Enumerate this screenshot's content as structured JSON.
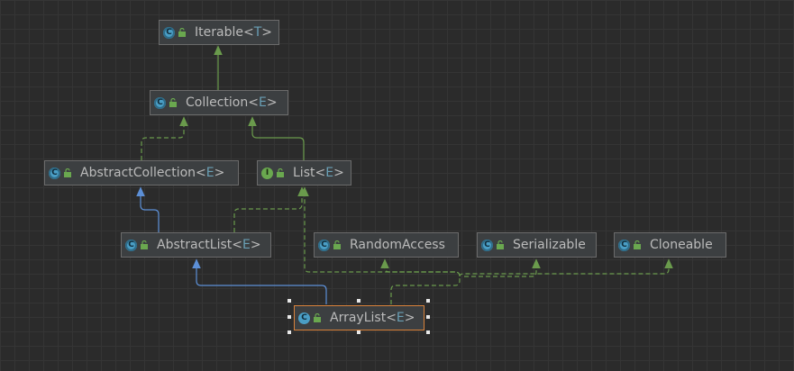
{
  "colors": {
    "background": "#2b2b2b",
    "node_fill": "#3c3f41",
    "node_border": "#6b6b6b",
    "selected_border": "#d9823b",
    "extends_edge": "#6a9a4c",
    "implements_edge": "#6a9a4c",
    "class_extends_edge": "#5c8fd6",
    "text": "#bbbbbb",
    "type_param": "#6a9fb5"
  },
  "nodes": [
    {
      "id": "iterable",
      "name": "Iterable",
      "type_param": "T",
      "kind": "interface-abstract",
      "icon": "abstract-class-icon"
    },
    {
      "id": "collection",
      "name": "Collection",
      "type_param": "E",
      "kind": "interface-abstract",
      "icon": "abstract-class-icon"
    },
    {
      "id": "abstractcollection",
      "name": "AbstractCollection",
      "type_param": "E",
      "kind": "abstract-class",
      "icon": "abstract-class-icon"
    },
    {
      "id": "list",
      "name": "List",
      "type_param": "E",
      "kind": "interface",
      "icon": "interface-icon"
    },
    {
      "id": "abstractlist",
      "name": "AbstractList",
      "type_param": "E",
      "kind": "abstract-class",
      "icon": "abstract-class-icon"
    },
    {
      "id": "randomaccess",
      "name": "RandomAccess",
      "type_param": "",
      "kind": "interface-abstract",
      "icon": "abstract-class-icon"
    },
    {
      "id": "serializable",
      "name": "Serializable",
      "type_param": "",
      "kind": "interface-abstract",
      "icon": "abstract-class-icon"
    },
    {
      "id": "cloneable",
      "name": "Cloneable",
      "type_param": "",
      "kind": "interface-abstract",
      "icon": "abstract-class-icon"
    },
    {
      "id": "arraylist",
      "name": "ArrayList",
      "type_param": "E",
      "kind": "class",
      "icon": "class-icon",
      "selected": true
    }
  ],
  "edges": [
    {
      "from": "collection",
      "to": "iterable",
      "style": "solid",
      "color": "green"
    },
    {
      "from": "abstractcollection",
      "to": "collection",
      "style": "dashed",
      "color": "green"
    },
    {
      "from": "list",
      "to": "collection",
      "style": "solid",
      "color": "green"
    },
    {
      "from": "abstractlist",
      "to": "abstractcollection",
      "style": "solid",
      "color": "blue"
    },
    {
      "from": "abstractlist",
      "to": "list",
      "style": "dashed",
      "color": "green"
    },
    {
      "from": "arraylist",
      "to": "abstractlist",
      "style": "solid",
      "color": "blue"
    },
    {
      "from": "arraylist",
      "to": "list",
      "style": "dashed",
      "color": "green"
    },
    {
      "from": "arraylist",
      "to": "randomaccess",
      "style": "dashed",
      "color": "green"
    },
    {
      "from": "arraylist",
      "to": "serializable",
      "style": "dashed",
      "color": "green"
    },
    {
      "from": "arraylist",
      "to": "cloneable",
      "style": "dashed",
      "color": "green"
    }
  ]
}
